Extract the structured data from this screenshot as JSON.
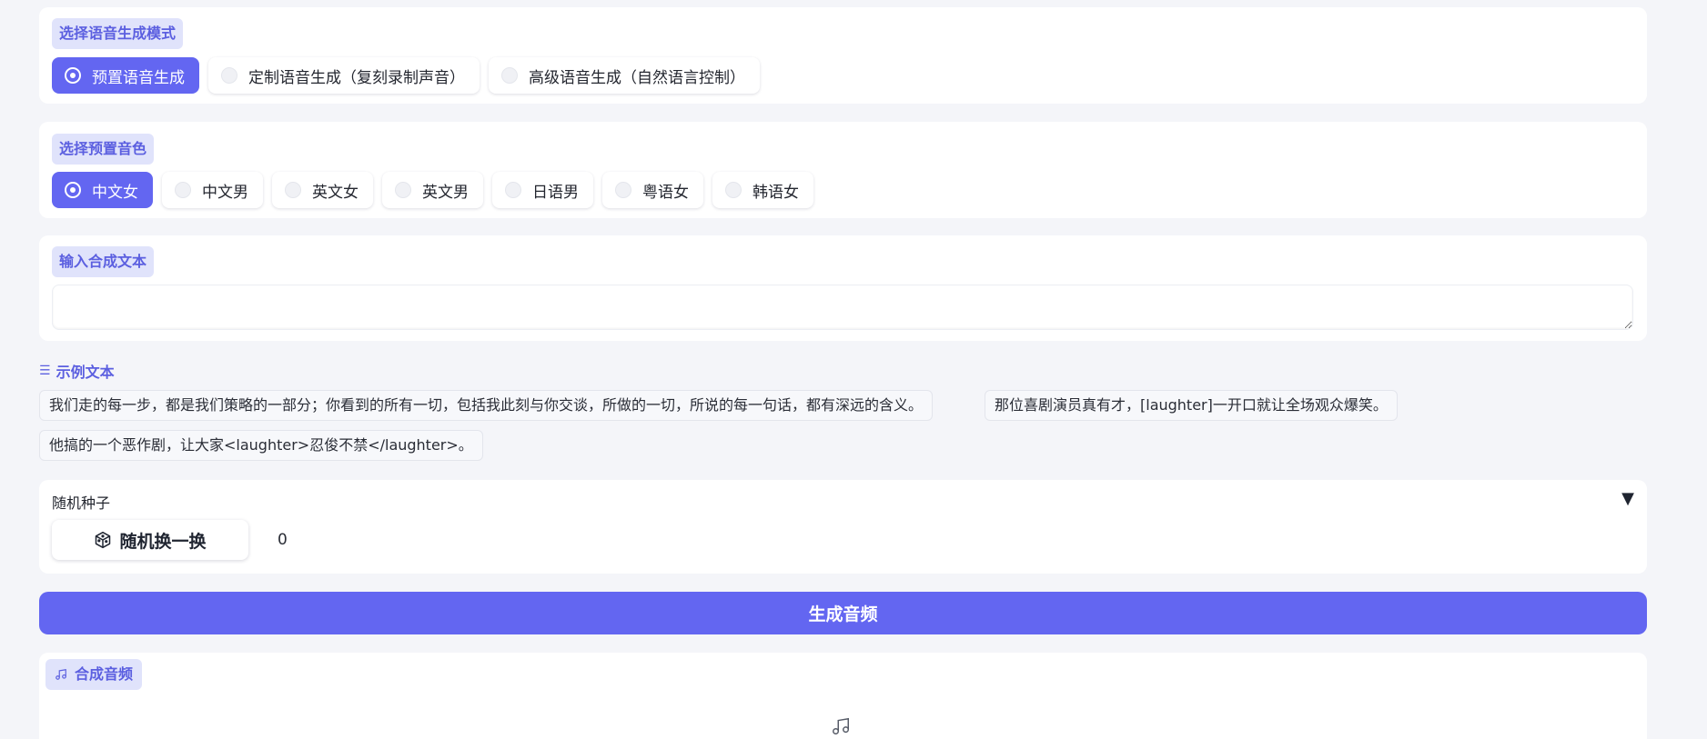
{
  "mode_section": {
    "label": "选择语音生成模式",
    "options": [
      "预置语音生成",
      "定制语音生成（复刻录制声音）",
      "高级语音生成（自然语言控制）"
    ],
    "selected": "预置语音生成"
  },
  "voice_section": {
    "label": "选择预置音色",
    "options": [
      "中文女",
      "中文男",
      "英文女",
      "英文男",
      "日语男",
      "粤语女",
      "韩语女"
    ],
    "selected": "中文女"
  },
  "text_section": {
    "label": "输入合成文本",
    "value": "",
    "placeholder": ""
  },
  "examples": {
    "title": "示例文本",
    "items": [
      "我们走的每一步，都是我们策略的一部分；你看到的所有一切，包括我此刻与你交谈，所做的一切，所说的每一句话，都有深远的含义。",
      "那位喜剧演员真有才，[laughter]一开口就让全场观众爆笑。",
      "他搞的一个恶作剧，让大家<laughter>忍俊不禁</laughter>。"
    ]
  },
  "seed_section": {
    "label": "随机种子",
    "collapse_icon": "▼",
    "button_label": "随机换一换",
    "value": "0"
  },
  "generate_button": {
    "label": "生成音频"
  },
  "output_section": {
    "label": "合成音频"
  },
  "icons": {
    "list": "list-icon",
    "dice": "dice-icon",
    "music_note": "music-note-icon"
  },
  "colors": {
    "accent": "#6366f1",
    "label_bg": "#e0e3fb",
    "label_text": "#5b5fe0",
    "page_bg": "#f4f5f9"
  }
}
